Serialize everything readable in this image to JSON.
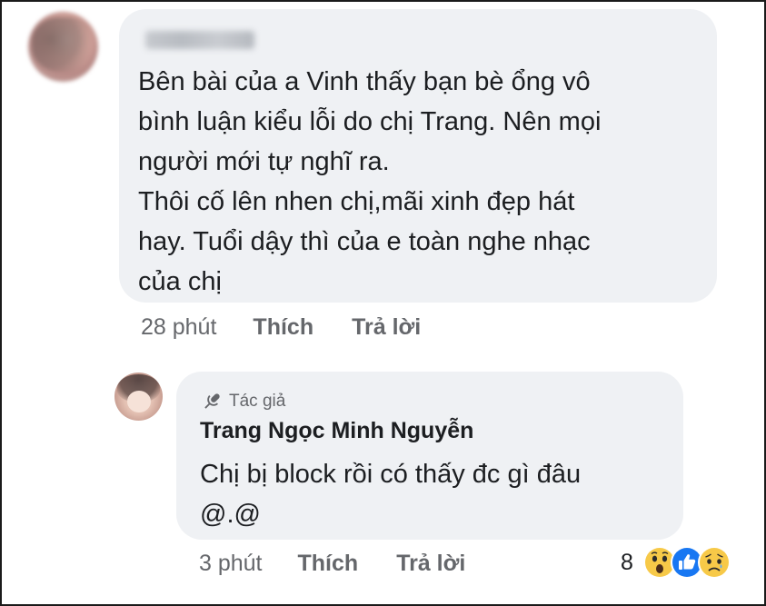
{
  "main_comment": {
    "lines": [
      "Bên bài của a Vinh thấy bạn bè ổng vô",
      "bình luận kiểu lỗi do chị Trang. Nên mọi",
      "người mới tự nghĩ ra.",
      "Thôi cố lên nhen chị,mãi xinh đẹp hát",
      "hay. Tuổi dậy thì của e toàn nghe nhạc",
      "của chị"
    ],
    "time": "28 phút",
    "like_label": "Thích",
    "reply_label": "Trả lời"
  },
  "reply": {
    "badge": "Tác giả",
    "author": "Trang Ngọc Minh Nguyễn",
    "lines": [
      "Chị bị block rồi có thấy đc gì đâu",
      "@.@"
    ],
    "time": "3 phút",
    "like_label": "Thích",
    "reply_label": "Trả lời",
    "reaction_count": "8",
    "reactions": [
      "wow-icon",
      "like-icon",
      "sad-icon"
    ]
  },
  "colors": {
    "bubble": "#eff1f4",
    "secondary_text": "#65676b",
    "like_blue": "#1877f2",
    "reaction_yellow": "#f7c948"
  }
}
